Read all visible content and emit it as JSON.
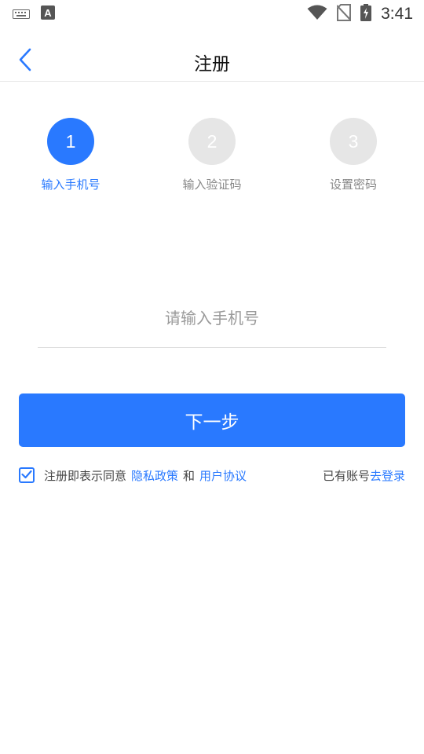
{
  "status_bar": {
    "time": "3:41",
    "icons": [
      "keyboard-icon",
      "text-a-icon",
      "wifi-icon",
      "no-sim-icon",
      "battery-charging-icon"
    ]
  },
  "header": {
    "title": "注册",
    "back_icon": "chevron-left-icon"
  },
  "steps": [
    {
      "number": "1",
      "label": "输入手机号",
      "state": "active"
    },
    {
      "number": "2",
      "label": "输入验证码",
      "state": "inactive"
    },
    {
      "number": "3",
      "label": "设置密码",
      "state": "inactive"
    }
  ],
  "form": {
    "phone_placeholder": "请输入手机号",
    "phone_value": "",
    "next_label": "下一步"
  },
  "agreement": {
    "checked": true,
    "prefix": "注册即表示同意",
    "privacy_link": "隐私政策",
    "and": "和",
    "terms_link": "用户协议"
  },
  "login": {
    "prefix": "已有账号",
    "link": "去登录"
  },
  "colors": {
    "accent": "#2979ff",
    "inactive_step": "#e6e6e6"
  }
}
